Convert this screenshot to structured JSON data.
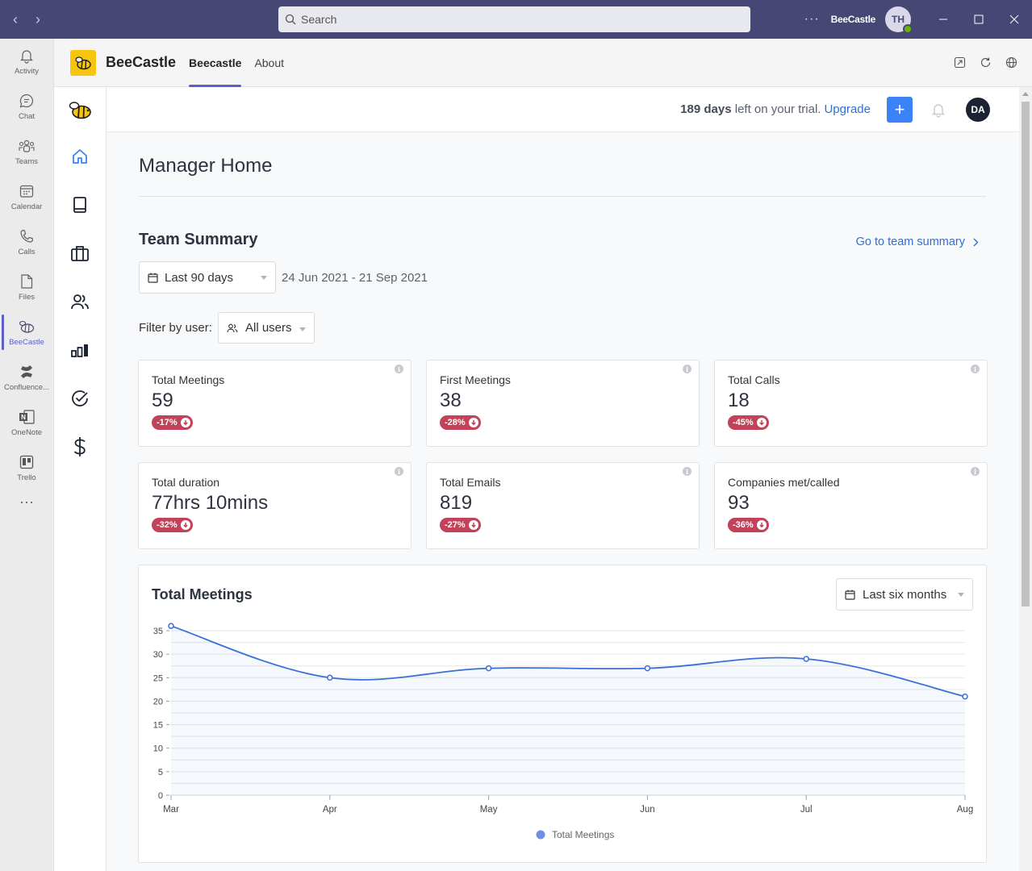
{
  "titlebar": {
    "search_placeholder": "Search",
    "more": "···",
    "org_name": "BeeCastle",
    "user_initials": "TH"
  },
  "rail": {
    "items": [
      {
        "label": "Activity",
        "icon": "bell-icon"
      },
      {
        "label": "Chat",
        "icon": "chat-icon"
      },
      {
        "label": "Teams",
        "icon": "teams-icon"
      },
      {
        "label": "Calendar",
        "icon": "calendar-icon"
      },
      {
        "label": "Calls",
        "icon": "phone-icon"
      },
      {
        "label": "Files",
        "icon": "file-icon"
      },
      {
        "label": "BeeCastle",
        "icon": "bee-icon"
      },
      {
        "label": "Confluence...",
        "icon": "confluence-icon"
      },
      {
        "label": "OneNote",
        "icon": "onenote-icon"
      },
      {
        "label": "Trello",
        "icon": "trello-icon"
      }
    ],
    "more": "···"
  },
  "app": {
    "name": "BeeCastle",
    "tabs": [
      {
        "label": "Beecastle",
        "active": true
      },
      {
        "label": "About",
        "active": false
      }
    ]
  },
  "topbar": {
    "trial_days": "189 days",
    "trial_text": " left on your trial.",
    "upgrade": "Upgrade",
    "plus": "+",
    "user_initials": "DA"
  },
  "main": {
    "title": "Manager Home",
    "section_title": "Team Summary",
    "team_link": "Go to team summary",
    "range_value": "Last 90 days",
    "date_range": "24 Jun 2021 - 21 Sep 2021",
    "filter_label": "Filter by user:",
    "user_filter_value": "All users"
  },
  "cards": [
    {
      "label": "Total Meetings",
      "value": "59",
      "change": "-17%"
    },
    {
      "label": "First Meetings",
      "value": "38",
      "change": "-28%"
    },
    {
      "label": "Total Calls",
      "value": "18",
      "change": "-45%"
    },
    {
      "label": "Total duration",
      "value": "77hrs 10mins",
      "change": "-32%"
    },
    {
      "label": "Total Emails",
      "value": "819",
      "change": "-27%"
    },
    {
      "label": "Companies met/called",
      "value": "93",
      "change": "-36%"
    }
  ],
  "chart_panel": {
    "title": "Total Meetings",
    "range_value": "Last six months"
  },
  "chart_data": {
    "type": "area",
    "categories": [
      "Mar",
      "Apr",
      "May",
      "Jun",
      "Jul",
      "Aug"
    ],
    "series": [
      {
        "name": "Total Meetings",
        "values": [
          36,
          25,
          27,
          27,
          29,
          21
        ]
      }
    ],
    "ylim": [
      0,
      35
    ],
    "yticks": [
      0,
      5,
      10,
      15,
      20,
      25,
      30,
      35
    ],
    "grid": true,
    "legend": "bottom",
    "color": "#3b6fd8"
  },
  "colors": {
    "teams_bar": "#464775",
    "accent": "#5b5fc7",
    "primary": "#3b82f6",
    "negative_badge": "#c2425a",
    "link": "#2f6fd6"
  }
}
